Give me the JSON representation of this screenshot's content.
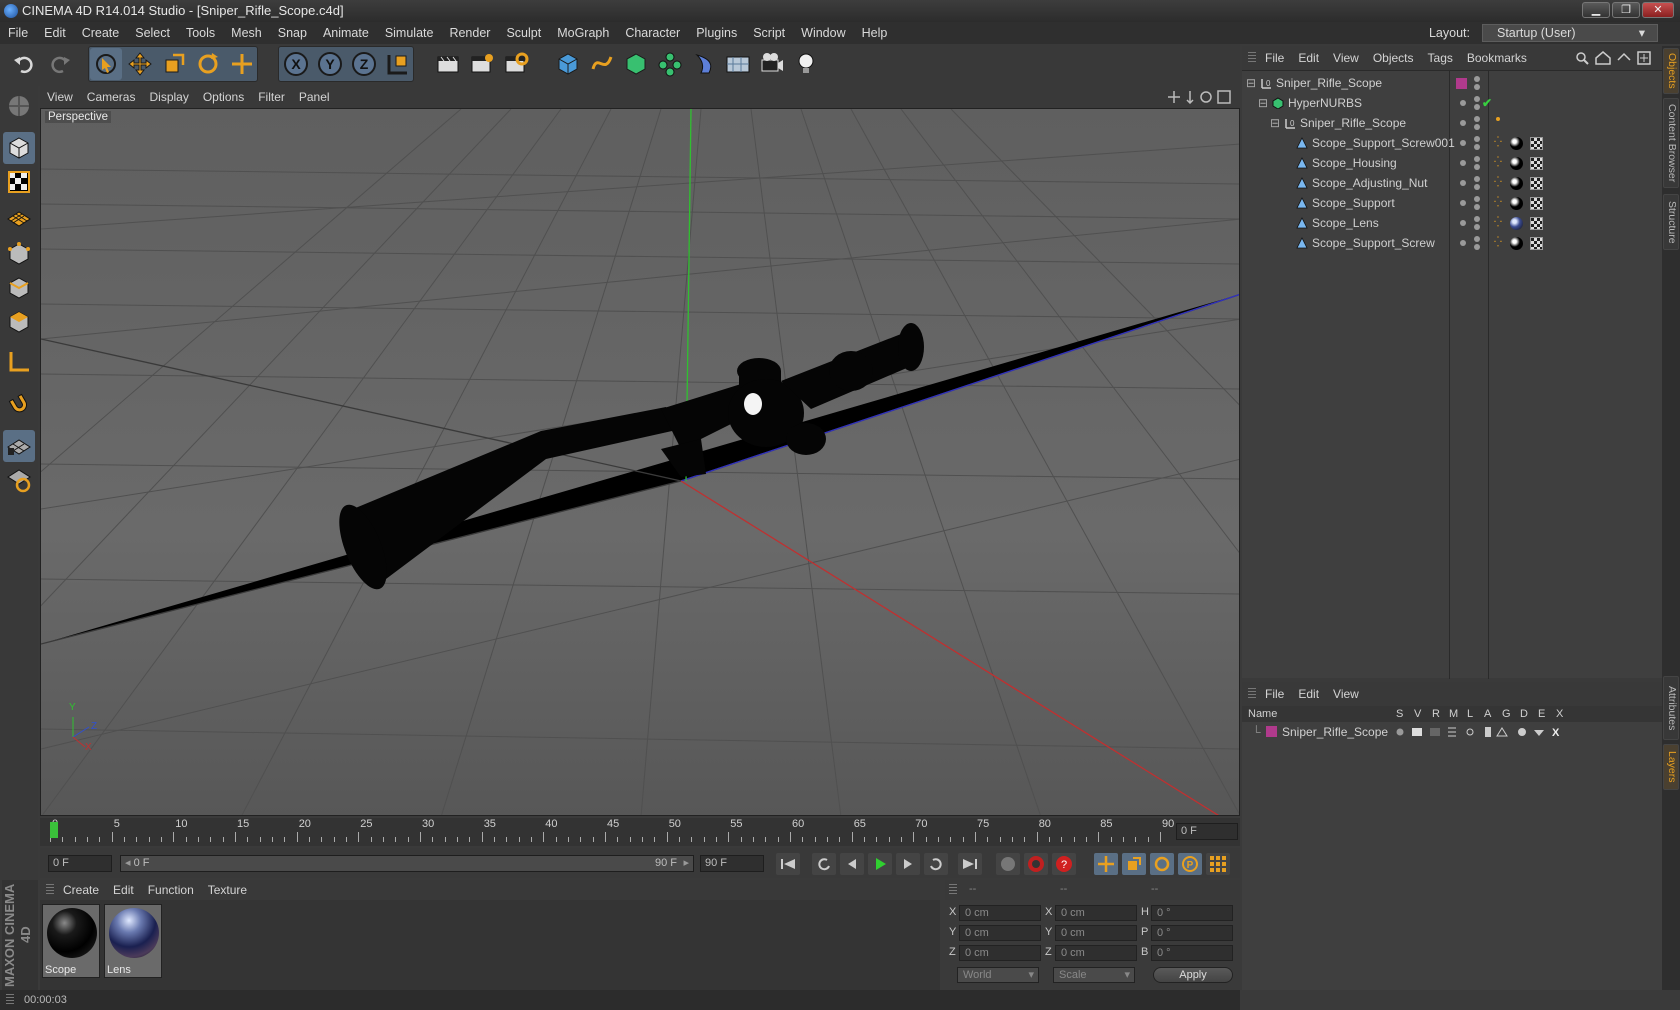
{
  "window": {
    "title": "CINEMA 4D R14.014 Studio - [Sniper_Rifle_Scope.c4d]"
  },
  "menubar": {
    "items": [
      "File",
      "Edit",
      "Create",
      "Select",
      "Tools",
      "Mesh",
      "Snap",
      "Animate",
      "Simulate",
      "Render",
      "Sculpt",
      "MoGraph",
      "Character",
      "Plugins",
      "Script",
      "Window",
      "Help"
    ],
    "layout_label": "Layout:",
    "layout_value": "Startup (User)"
  },
  "toolbar": {
    "icons": [
      "undo-icon",
      "redo-icon",
      "live-selection-icon",
      "move-icon",
      "scale-icon",
      "rotate-icon",
      "transform-icon",
      "x-axis-lock-icon",
      "y-axis-lock-icon",
      "z-axis-lock-icon",
      "world-coordinates-icon",
      "render-view-icon",
      "render-picture-viewer-icon",
      "render-settings-icon",
      "cube-object-icon",
      "spline-icon",
      "nurbs-icon",
      "array-icon",
      "deformer-icon",
      "environment-icon",
      "camera-icon",
      "light-icon"
    ],
    "axis_labels": [
      "X",
      "Y",
      "Z"
    ]
  },
  "left_tools": [
    "model-mode-icon",
    "texture-mode-icon",
    "workplane-icon",
    "points-mode-icon",
    "edges-mode-icon",
    "polygons-mode-icon",
    "axis-mode-icon",
    "magnet-icon",
    "snapping-grid-icon",
    "locked-workplane-icon"
  ],
  "viewport": {
    "menu": [
      "View",
      "Cameras",
      "Display",
      "Options",
      "Filter",
      "Panel"
    ],
    "label": "Perspective",
    "axis_gizmo": {
      "x": "X",
      "y": "Y",
      "z": "Z"
    }
  },
  "timeline": {
    "ticks": [
      "0",
      "5",
      "10",
      "15",
      "20",
      "25",
      "30",
      "35",
      "40",
      "45",
      "50",
      "55",
      "60",
      "65",
      "70",
      "75",
      "80",
      "85",
      "90"
    ],
    "current_frame_field": "0 F",
    "start_field": "0 F",
    "range_start": "0 F",
    "range_end": "90 F",
    "end_field": "90 F"
  },
  "materials": {
    "menu": [
      "Create",
      "Edit",
      "Function",
      "Texture"
    ],
    "items": [
      {
        "name": "Scope"
      },
      {
        "name": "Lens"
      }
    ]
  },
  "coordinates": {
    "headers": [
      "--",
      "--",
      "--"
    ],
    "rows": [
      {
        "l1": "X",
        "v1": "0 cm",
        "l2": "X",
        "v2": "0 cm",
        "l3": "H",
        "v3": "0 °"
      },
      {
        "l1": "Y",
        "v1": "0 cm",
        "l2": "Y",
        "v2": "0 cm",
        "l3": "P",
        "v3": "0 °"
      },
      {
        "l1": "Z",
        "v1": "0 cm",
        "l2": "Z",
        "v2": "0 cm",
        "l3": "B",
        "v3": "0 °"
      }
    ],
    "mode": "World",
    "type": "Scale",
    "apply": "Apply"
  },
  "status": {
    "time": "00:00:03"
  },
  "brand": "MAXON CINEMA 4D",
  "objects": {
    "menu": [
      "File",
      "Edit",
      "View",
      "Objects",
      "Tags",
      "Bookmarks"
    ],
    "tree": [
      {
        "name": "Sniper_Rifle_Scope",
        "indent": 0,
        "icon": "null-object-icon"
      },
      {
        "name": "HyperNURBS",
        "indent": 1,
        "icon": "hypernurbs-icon"
      },
      {
        "name": "Sniper_Rifle_Scope",
        "indent": 2,
        "icon": "null-object-icon"
      },
      {
        "name": "Scope_Support_Screw001",
        "indent": 3,
        "icon": "polygon-object-icon"
      },
      {
        "name": "Scope_Housing",
        "indent": 3,
        "icon": "polygon-object-icon"
      },
      {
        "name": "Scope_Adjusting_Nut",
        "indent": 3,
        "icon": "polygon-object-icon"
      },
      {
        "name": "Scope_Support",
        "indent": 3,
        "icon": "polygon-object-icon"
      },
      {
        "name": "Scope_Lens",
        "indent": 3,
        "icon": "polygon-object-icon"
      },
      {
        "name": "Scope_Support_Screw",
        "indent": 3,
        "icon": "polygon-object-icon"
      }
    ]
  },
  "layers": {
    "menu": [
      "File",
      "Edit",
      "View"
    ],
    "columns": [
      "Name",
      "S",
      "V",
      "R",
      "M",
      "L",
      "A",
      "G",
      "D",
      "E",
      "X"
    ],
    "rows": [
      {
        "name": "Sniper_Rifle_Scope",
        "color": "#b03a8c"
      }
    ]
  },
  "side_tabs": [
    "Objects",
    "Content Browser",
    "Structure",
    "Attributes",
    "Layers"
  ],
  "colors": {
    "accent": "#e8a020",
    "layer": "#b03a8c",
    "axis_x": "#c03030",
    "axis_y": "#30c030",
    "axis_z": "#3030c0"
  }
}
